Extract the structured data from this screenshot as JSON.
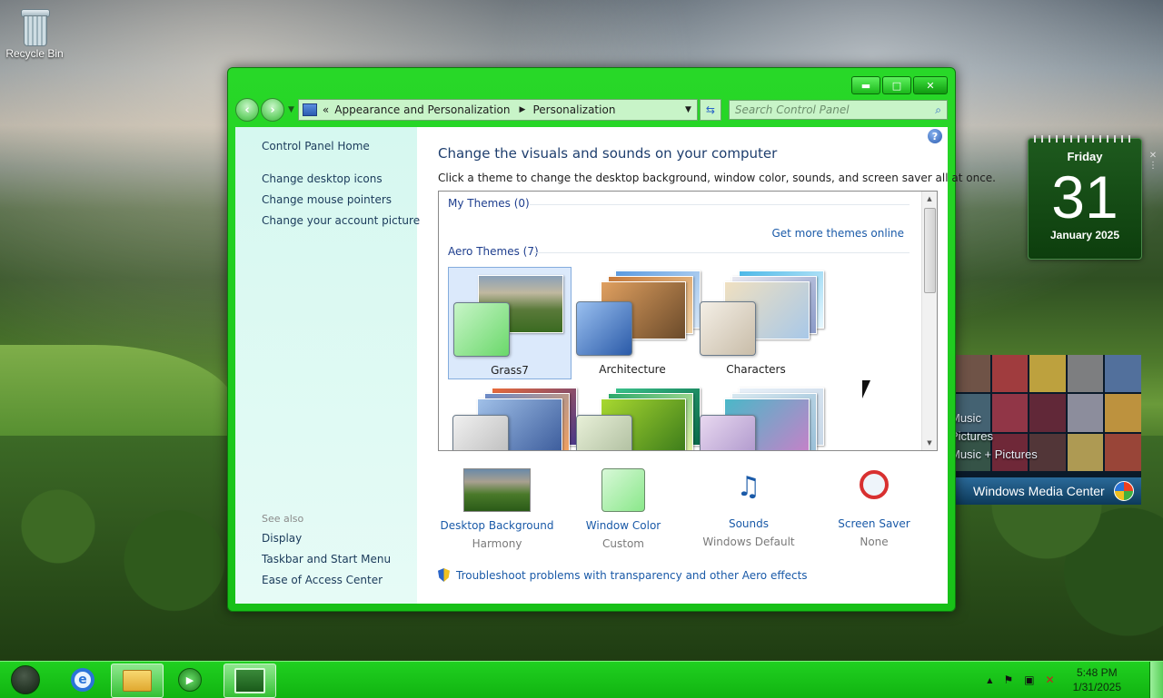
{
  "desktop": {
    "recycle_bin_label": "Recycle Bin"
  },
  "window": {
    "controls": {
      "minimize": "▬",
      "maximize": "□",
      "close": "✕"
    },
    "address": {
      "prefix": "«",
      "crumb1": "Appearance and Personalization",
      "crumb2": "Personalization"
    },
    "search_placeholder": "Search Control Panel",
    "help": "?"
  },
  "sidebar": {
    "home": "Control Panel Home",
    "links": [
      "Change desktop icons",
      "Change mouse pointers",
      "Change your account picture"
    ],
    "see_also_label": "See also",
    "see_also": [
      "Display",
      "Taskbar and Start Menu",
      "Ease of Access Center"
    ]
  },
  "main": {
    "title": "Change the visuals and sounds on your computer",
    "description": "Click a theme to change the desktop background, window color, sounds, and screen saver all at once.",
    "my_themes": "My Themes (0)",
    "get_more": "Get more themes online",
    "aero_themes": "Aero Themes (7)",
    "themes": [
      {
        "name": "Grass7",
        "selected": true
      },
      {
        "name": "Architecture",
        "selected": false
      },
      {
        "name": "Characters",
        "selected": false
      }
    ],
    "bottom": [
      {
        "label": "Desktop Background",
        "value": "Harmony"
      },
      {
        "label": "Window Color",
        "value": "Custom"
      },
      {
        "label": "Sounds",
        "value": "Windows Default"
      },
      {
        "label": "Screen Saver",
        "value": "None"
      }
    ],
    "troubleshoot": "Troubleshoot problems with transparency and other Aero effects"
  },
  "calendar": {
    "day": "Friday",
    "date": "31",
    "month": "January 2025"
  },
  "media_center": {
    "items": [
      "Music",
      "Pictures",
      "Music + Pictures"
    ],
    "title": "Windows Media Center"
  },
  "taskbar": {
    "time": "5:48 PM",
    "date": "1/31/2025",
    "tray_expand": "▲"
  },
  "colors": {
    "accent": "#18c018",
    "link": "#1a5aa8",
    "heading": "#1e3e6e"
  }
}
